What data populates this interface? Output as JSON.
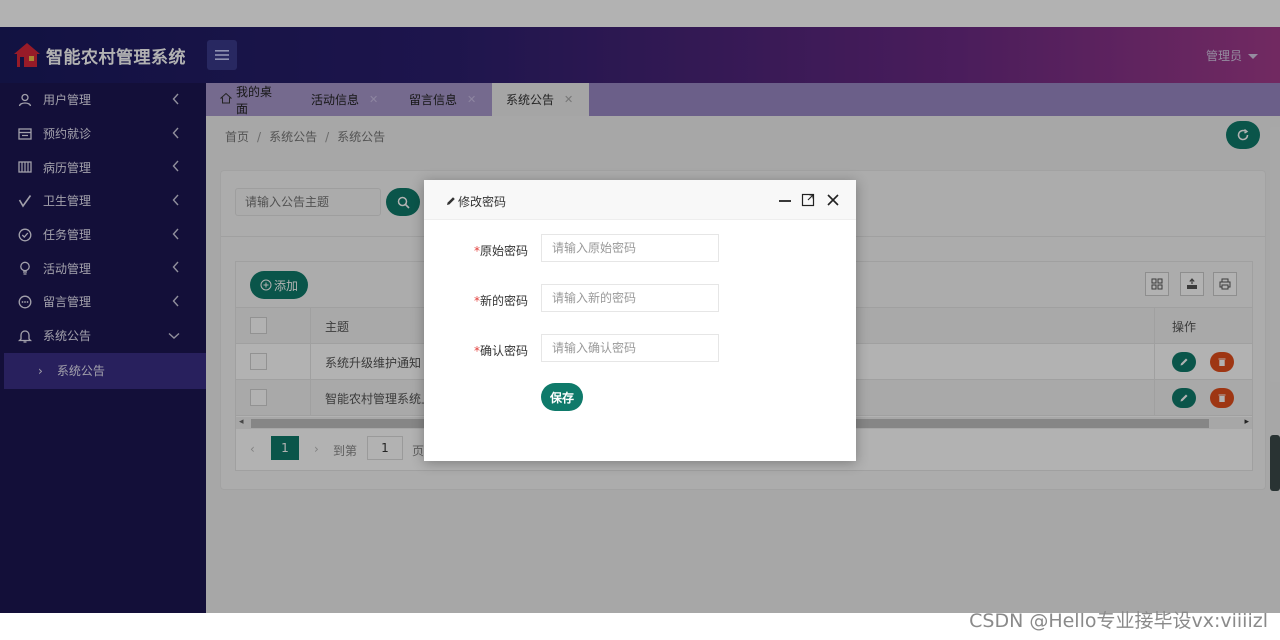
{
  "app": {
    "title": "智能农村管理系统",
    "user": "管理员"
  },
  "colors": {
    "header_gradient": [
      "#1a1a5e",
      "#6b2a84",
      "#a33c8c"
    ],
    "sidebar_bg": "#1c1652",
    "sidebar_active": "#3a2f86",
    "primary": "#0f7a6a",
    "danger": "#e24e1c",
    "tabs_bg": "#9a89c4"
  },
  "sidebar": {
    "items": [
      {
        "label": "用户管理",
        "icon": "user-icon"
      },
      {
        "label": "预约就诊",
        "icon": "calendar-icon"
      },
      {
        "label": "病历管理",
        "icon": "records-icon"
      },
      {
        "label": "卫生管理",
        "icon": "check-icon"
      },
      {
        "label": "任务管理",
        "icon": "task-icon"
      },
      {
        "label": "活动管理",
        "icon": "bulb-icon"
      },
      {
        "label": "留言管理",
        "icon": "message-icon"
      },
      {
        "label": "系统公告",
        "icon": "bell-icon"
      }
    ],
    "sub_item": "系统公告"
  },
  "tabs": [
    {
      "label": "我的桌面",
      "icon": "home-icon"
    },
    {
      "label": "活动信息"
    },
    {
      "label": "留言信息"
    },
    {
      "label": "系统公告",
      "active": true
    }
  ],
  "breadcrumb": [
    "首页",
    "系统公告",
    "系统公告"
  ],
  "search": {
    "placeholder": "请输入公告主题"
  },
  "table": {
    "add_label": "添加",
    "headers": {
      "subject": "主题",
      "ops": "操作"
    },
    "rows": [
      {
        "subject": "系统升级维护通知"
      },
      {
        "subject": "智能农村管理系统上"
      }
    ]
  },
  "pager": {
    "current": "1",
    "goto_label": "到第",
    "goto_value": "1",
    "page_label": "页"
  },
  "dialog": {
    "title": "修改密码",
    "fields": [
      {
        "label": "原始密码",
        "placeholder": "请输入原始密码"
      },
      {
        "label": "新的密码",
        "placeholder": "请输入新的密码"
      },
      {
        "label": "确认密码",
        "placeholder": "请输入确认密码"
      }
    ],
    "save_label": "保存"
  },
  "watermark": "CSDN @Hello专业接毕设vx:viiiizl"
}
